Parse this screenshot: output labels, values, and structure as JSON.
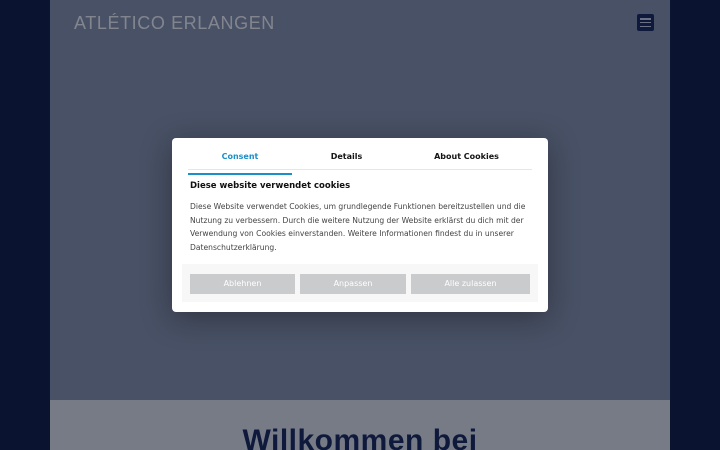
{
  "site": {
    "brand": "ATLÉTICO ERLANGEN",
    "welcome_heading": "Willkommen bei",
    "menu_icon": "hamburger-menu-icon"
  },
  "cookie_dialog": {
    "tabs": [
      {
        "label": "Consent",
        "active": true
      },
      {
        "label": "Details",
        "active": false
      },
      {
        "label": "About Cookies",
        "active": false
      }
    ],
    "title": "Diese website verwendet cookies",
    "body": "Diese Website verwendet Cookies, um grundlegende Funktionen bereitzustellen und die Nutzung zu verbessern. Durch die weitere Nutzung der Website erklärst du dich mit der Verwendung von Cookies einverstanden. Weitere Informationen findest du in unserer Datenschutzerklärung.",
    "buttons": {
      "decline": "Ablehnen",
      "customize": "Anpassen",
      "accept_all": "Alle zulassen"
    }
  },
  "colors": {
    "background_navy": "#0f1d44",
    "active_tab": "#1a8fc9",
    "button_grey": "#c9cbcc",
    "heading_navy": "#17275a"
  }
}
